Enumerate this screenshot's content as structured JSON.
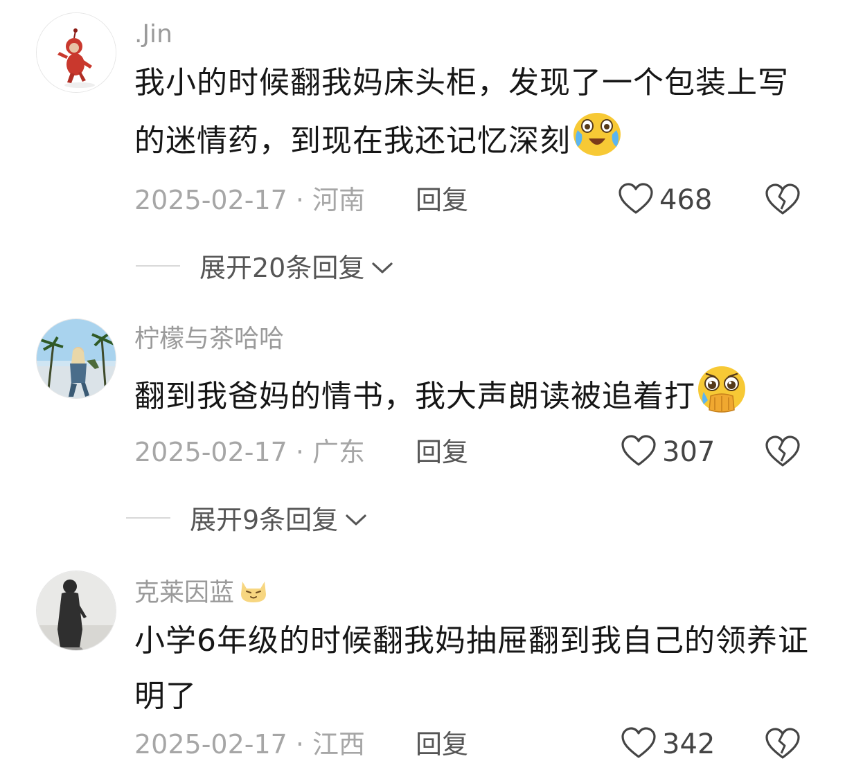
{
  "comments": [
    {
      "username": ".Jin",
      "text": "我小的时候翻我妈床头柜，发现了一个包装上写的迷情药，到现在我还记忆深刻",
      "emoji": "crying-laughing-emoji",
      "date": "2025-02-17",
      "location": "河南",
      "reply_label": "回复",
      "likes": "468",
      "expand_label": "展开20条回复"
    },
    {
      "username": "柠檬与茶哈哈",
      "text": "翻到我爸妈的情书，我大声朗读被追着打",
      "emoji": "pleading-hands-emoji",
      "date": "2025-02-17",
      "location": "广东",
      "reply_label": "回复",
      "likes": "307",
      "expand_label": "展开9条回复"
    },
    {
      "username": "克莱因蓝",
      "username_badge": "cat-emoji",
      "text": "小学6年级的时候翻我妈抽屉翻到我自己的领养证明了",
      "date": "2025-02-17",
      "location": "江西",
      "reply_label": "回复",
      "likes": "342"
    }
  ],
  "separator": "·",
  "colors": {
    "meta": "#a6a6a6",
    "username": "#9a9a9a",
    "text": "#161616"
  }
}
